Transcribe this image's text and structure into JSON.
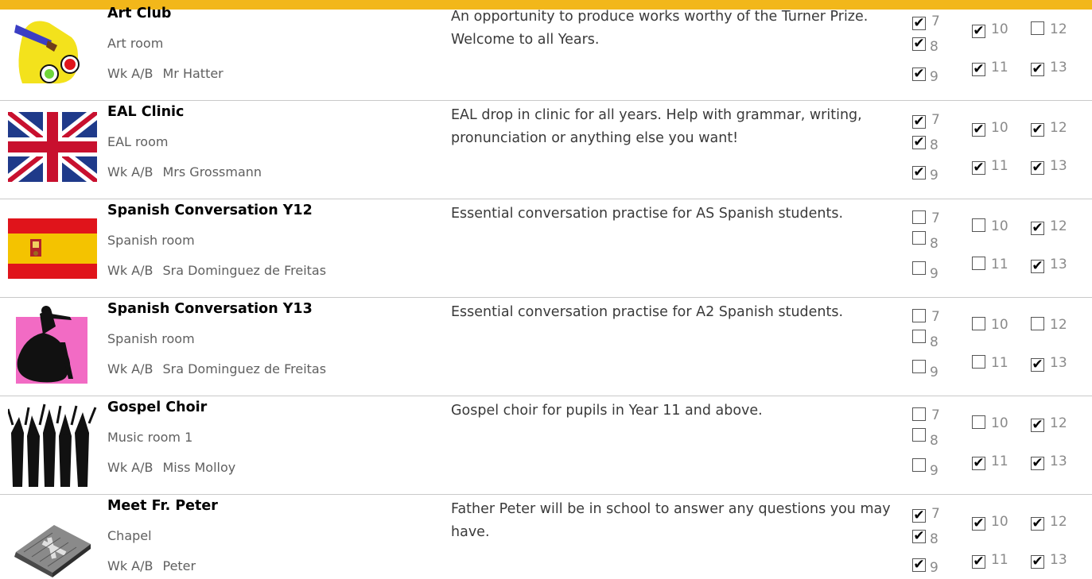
{
  "rows": [
    {
      "title": "Art Club",
      "room": "Art room",
      "week": "Wk  A/B",
      "teacher": "Mr Hatter",
      "description": "An opportunity to produce works worthy of the Turner Prize.  Welcome to all Years.",
      "icon": "art-palette-icon",
      "years": {
        "7": true,
        "8": true,
        "9": true,
        "10": true,
        "11": true,
        "12": false,
        "13": true
      }
    },
    {
      "title": "EAL Clinic",
      "room": "EAL room",
      "week": "Wk  A/B",
      "teacher": "Mrs Grossmann",
      "description": "EAL drop in clinic for all years. Help with grammar, writing, pronunciation or anything else you want!",
      "icon": "union-jack-flag-icon",
      "years": {
        "7": true,
        "8": true,
        "9": true,
        "10": true,
        "11": true,
        "12": true,
        "13": true
      }
    },
    {
      "title": "Spanish Conversation Y12",
      "room": "Spanish room",
      "week": "Wk  A/B",
      "teacher": "Sra Dominguez de Freitas",
      "description": "Essential conversation practise for AS Spanish students.",
      "icon": "spain-flag-icon",
      "years": {
        "7": false,
        "8": false,
        "9": false,
        "10": false,
        "11": false,
        "12": true,
        "13": true
      }
    },
    {
      "title": "Spanish Conversation Y13",
      "room": "Spanish room",
      "week": "Wk  A/B",
      "teacher": "Sra Dominguez de Freitas",
      "description": "Essential conversation practise for A2 Spanish students.",
      "icon": "flamenco-dancer-icon",
      "years": {
        "7": false,
        "8": false,
        "9": false,
        "10": false,
        "11": false,
        "12": false,
        "13": true
      }
    },
    {
      "title": "Gospel Choir",
      "room": "Music room 1",
      "week": "Wk  A/B",
      "teacher": "Miss Molloy",
      "description": "Gospel choir for pupils in Year 11 and above.",
      "icon": "choir-singers-icon",
      "years": {
        "7": false,
        "8": false,
        "9": false,
        "10": false,
        "11": true,
        "12": true,
        "13": true
      }
    },
    {
      "title": "Meet Fr. Peter",
      "room": "Chapel",
      "week": "Wk  A/B",
      "teacher": "Peter",
      "description": "Father Peter will be in school to answer any questions you may have.",
      "icon": "bible-cross-icon",
      "years": {
        "7": true,
        "8": true,
        "9": true,
        "10": true,
        "11": true,
        "12": true,
        "13": true
      }
    }
  ],
  "year_labels": {
    "y7": "7",
    "y8": "8",
    "y9": "9",
    "y10": "10",
    "y11": "11",
    "y12": "12",
    "y13": "13"
  },
  "colors": {
    "header_bar": "#f2b71a",
    "row_divider": "#c9c9c9",
    "pink_background": "#f26bc4"
  }
}
